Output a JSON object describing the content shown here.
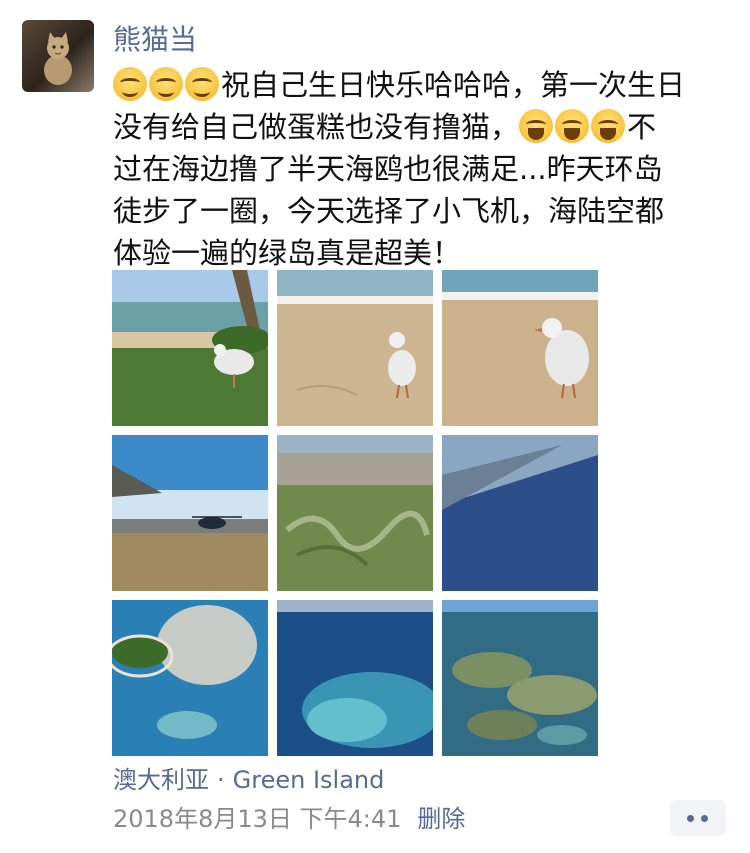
{
  "post": {
    "author": "熊猫当",
    "text_lines": [
      "祝自己生日快乐哈哈哈，第一次生日",
      "没有给自己做蛋糕也没有撸猫，",
      "不",
      "过在海边撸了半天海鸥也很满足...昨天环岛",
      "徒步了一圈，今天选择了小飞机，海陆空都",
      "体验一遍的绿岛真是超美！"
    ],
    "emojis": [
      "smiling-face-icon",
      "smiling-face-icon",
      "smiling-face-icon",
      "tears-of-joy-icon",
      "tears-of-joy-icon",
      "tears-of-joy-icon"
    ],
    "photos": [
      {
        "name": "photo-seagull-palm"
      },
      {
        "name": "photo-seagull-beach"
      },
      {
        "name": "photo-seagull-close"
      },
      {
        "name": "photo-helicopter"
      },
      {
        "name": "photo-aerial-river"
      },
      {
        "name": "photo-aerial-sea"
      },
      {
        "name": "photo-island-reef"
      },
      {
        "name": "photo-reef-water"
      },
      {
        "name": "photo-reef-close"
      }
    ]
  },
  "location": {
    "country": "澳大利亚",
    "separator": "·",
    "place": "Green Island"
  },
  "meta": {
    "timestamp": "2018年8月13日 下午4:41",
    "delete_label": "删除"
  },
  "colors": {
    "link": "#576b95",
    "text": "#111111",
    "meta": "#8a8a8a"
  }
}
